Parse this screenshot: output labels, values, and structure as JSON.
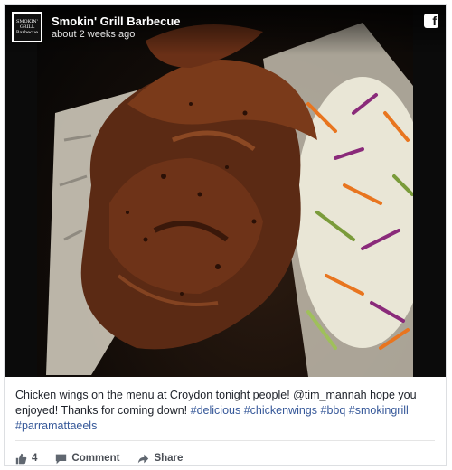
{
  "post": {
    "page_name": "Smokin' Grill Barbecue",
    "timestamp": "about 2 weeks ago",
    "logo_text": "SMOKIN' GRILL",
    "logo_subtext": "Barbecue",
    "network_icon": "facebook-icon",
    "caption_text": "Chicken wings on the menu at Croydon tonight people! @tim_mannah hope you enjoyed! Thanks for coming down! ",
    "hashtags": [
      "#delicious",
      "#chickenwings",
      "#bbq",
      "#smokingrill",
      "#parramattaeels"
    ]
  },
  "actions": {
    "like_count": "4",
    "comment_label": "Comment",
    "share_label": "Share"
  },
  "colors": {
    "link": "#365899",
    "text": "#1d2129",
    "action_text": "#4b4f56",
    "border": "#dddfe2"
  }
}
